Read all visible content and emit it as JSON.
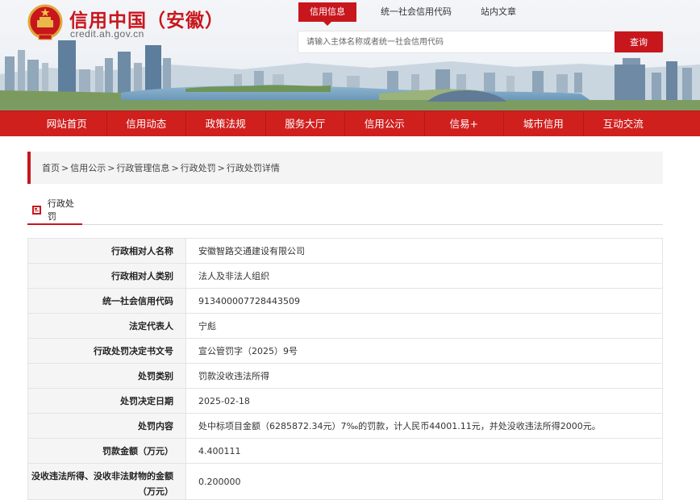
{
  "header": {
    "title": "信用中国（安徽）",
    "domain": "credit.ah.gov.cn",
    "tabs": [
      "信用信息",
      "统一社会信用代码",
      "站内文章"
    ],
    "search_placeholder": "请输入主体名称或者统一社会信用代码",
    "search_button": "查询"
  },
  "nav": [
    "网站首页",
    "信用动态",
    "政策法规",
    "服务大厅",
    "信用公示",
    "信易+",
    "城市信用",
    "互动交流"
  ],
  "breadcrumb": [
    "首页",
    "信用公示",
    "行政管理信息",
    "行政处罚",
    "行政处罚详情"
  ],
  "section": {
    "title": "行政处罚"
  },
  "details": [
    {
      "label": "行政相对人名称",
      "value": "安徽智路交通建设有限公司"
    },
    {
      "label": "行政相对人类别",
      "value": "法人及非法人组织"
    },
    {
      "label": "统一社会信用代码",
      "value": "913400007728443509"
    },
    {
      "label": "法定代表人",
      "value": "宁彪"
    },
    {
      "label": "行政处罚决定书文号",
      "value": "宣公管罚字（2025）9号"
    },
    {
      "label": "处罚类别",
      "value": "罚款没收违法所得"
    },
    {
      "label": "处罚决定日期",
      "value": "2025-02-18"
    },
    {
      "label": "处罚内容",
      "value": "处中标项目金额（6285872.34元）7‰的罚款，计人民币44001.11元，并处没收违法所得2000元。"
    },
    {
      "label": "罚款金额（万元）",
      "value": "4.400111"
    },
    {
      "label": "没收违法所得、没收非法财物的金额（万元）",
      "value": "0.200000"
    }
  ],
  "colors": {
    "brand_red": "#c8161d",
    "nav_red": "#d0201e"
  }
}
